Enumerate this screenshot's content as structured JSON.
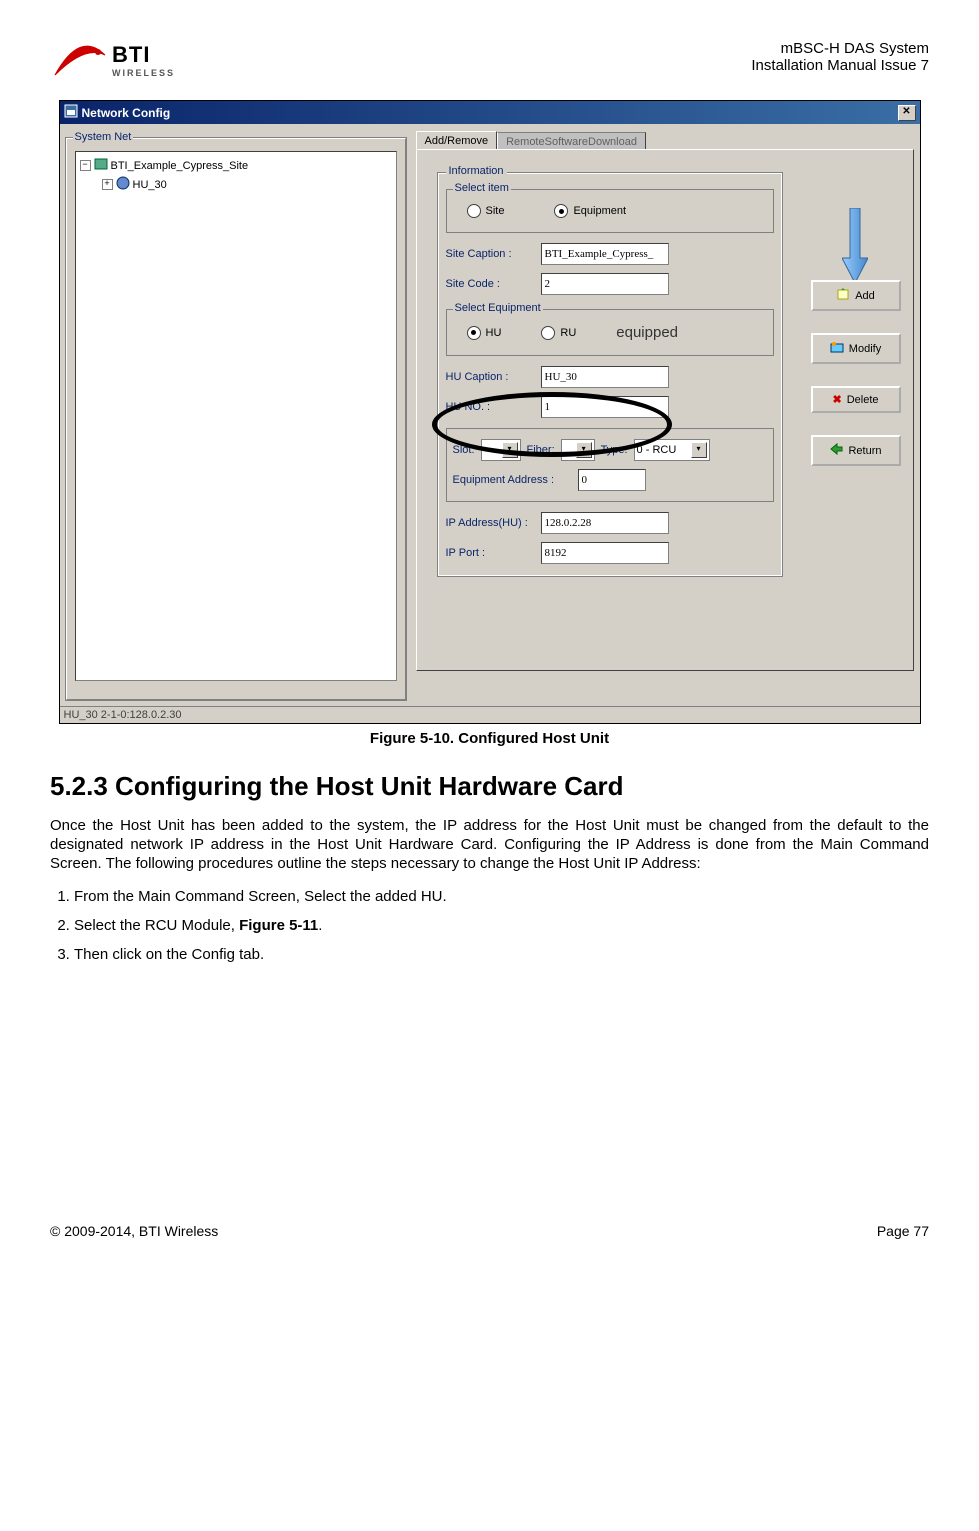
{
  "header": {
    "logo_main": "BTI",
    "logo_sub": "WIRELESS",
    "line1": "mBSC-H DAS System",
    "line2": "Installation Manual Issue 7"
  },
  "window": {
    "title": "Network Config",
    "statusbar": "HU_30 2-1-0:128.0.2.30"
  },
  "tree": {
    "group_label": "System Net",
    "root": "BTI_Example_Cypress_Site",
    "child": "HU_30"
  },
  "tabs": {
    "active": "Add/Remove",
    "inactive": "RemoteSoftwareDownload"
  },
  "info": {
    "group_label": "Information",
    "select_item_label": "Select item",
    "site_radio": "Site",
    "equipment_radio": "Equipment",
    "site_caption_label": "Site Caption :",
    "site_caption_value": "BTI_Example_Cypress_",
    "site_code_label": "Site Code :",
    "site_code_value": "2",
    "select_equipment_label": "Select Equipment",
    "hu_radio": "HU",
    "ru_radio": "RU",
    "equipped_text": "equipped",
    "hu_caption_label": "HU Caption :",
    "hu_caption_value": "HU_30",
    "hu_no_label": "HU NO. :",
    "hu_no_value": "1",
    "slot_label": "Slot:",
    "fiber_label": "Fiber:",
    "type_label": "Type:",
    "type_value": "0 - RCU",
    "equip_addr_label": "Equipment Address :",
    "equip_addr_value": "0",
    "ip_address_label": "IP Address(HU) :",
    "ip_address_value": "128.0.2.28",
    "ip_port_label": "IP Port :",
    "ip_port_value": "8192"
  },
  "buttons": {
    "add": "Add",
    "modify": "Modify",
    "delete": "Delete",
    "return": "Return"
  },
  "caption": "Figure 5-10. Configured Host Unit",
  "section": {
    "heading": "5.2.3  Configuring the Host Unit Hardware Card",
    "para": "Once the Host Unit has been added to the system, the IP address for the Host Unit must be changed from the default to the designated network IP address in the Host Unit Hardware Card. Configuring the IP Address is done from the Main Command Screen. The following procedures outline the steps necessary to change the Host Unit IP Address:",
    "step1": "From the Main Command Screen, Select the added HU.",
    "step2_pre": "Select the RCU Module, ",
    "step2_bold": "Figure 5-11",
    "step2_post": ".",
    "step3": "Then click on the Config tab."
  },
  "footer": {
    "left": "© 2009-2014, BTI Wireless",
    "right": "Page 77"
  }
}
